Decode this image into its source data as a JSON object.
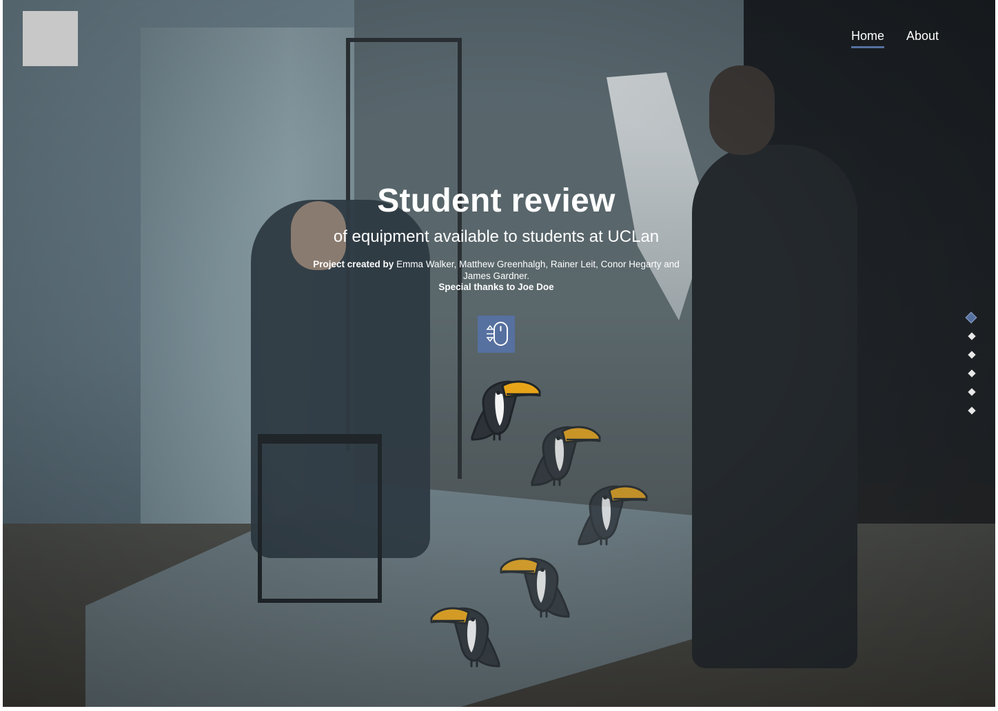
{
  "nav": {
    "home": "Home",
    "about": "About"
  },
  "hero": {
    "title": "Student review",
    "subtitle": "of equipment available to students at UCLan",
    "credits_label": "Project created by",
    "credits_names": "Emma Walker, Matthew Greenhalgh, Rainer Leit, Conor Hegarty and James Gardner.",
    "thanks": "Special thanks to Joe Doe"
  },
  "scroll_button": {
    "icon": "mouse-scroll-icon"
  },
  "section_dots": {
    "count": 6,
    "active_index": 0
  },
  "colors": {
    "accent": "#5670a0",
    "toucan_beak": "#e8a419",
    "toucan_body": "#2c3238"
  }
}
